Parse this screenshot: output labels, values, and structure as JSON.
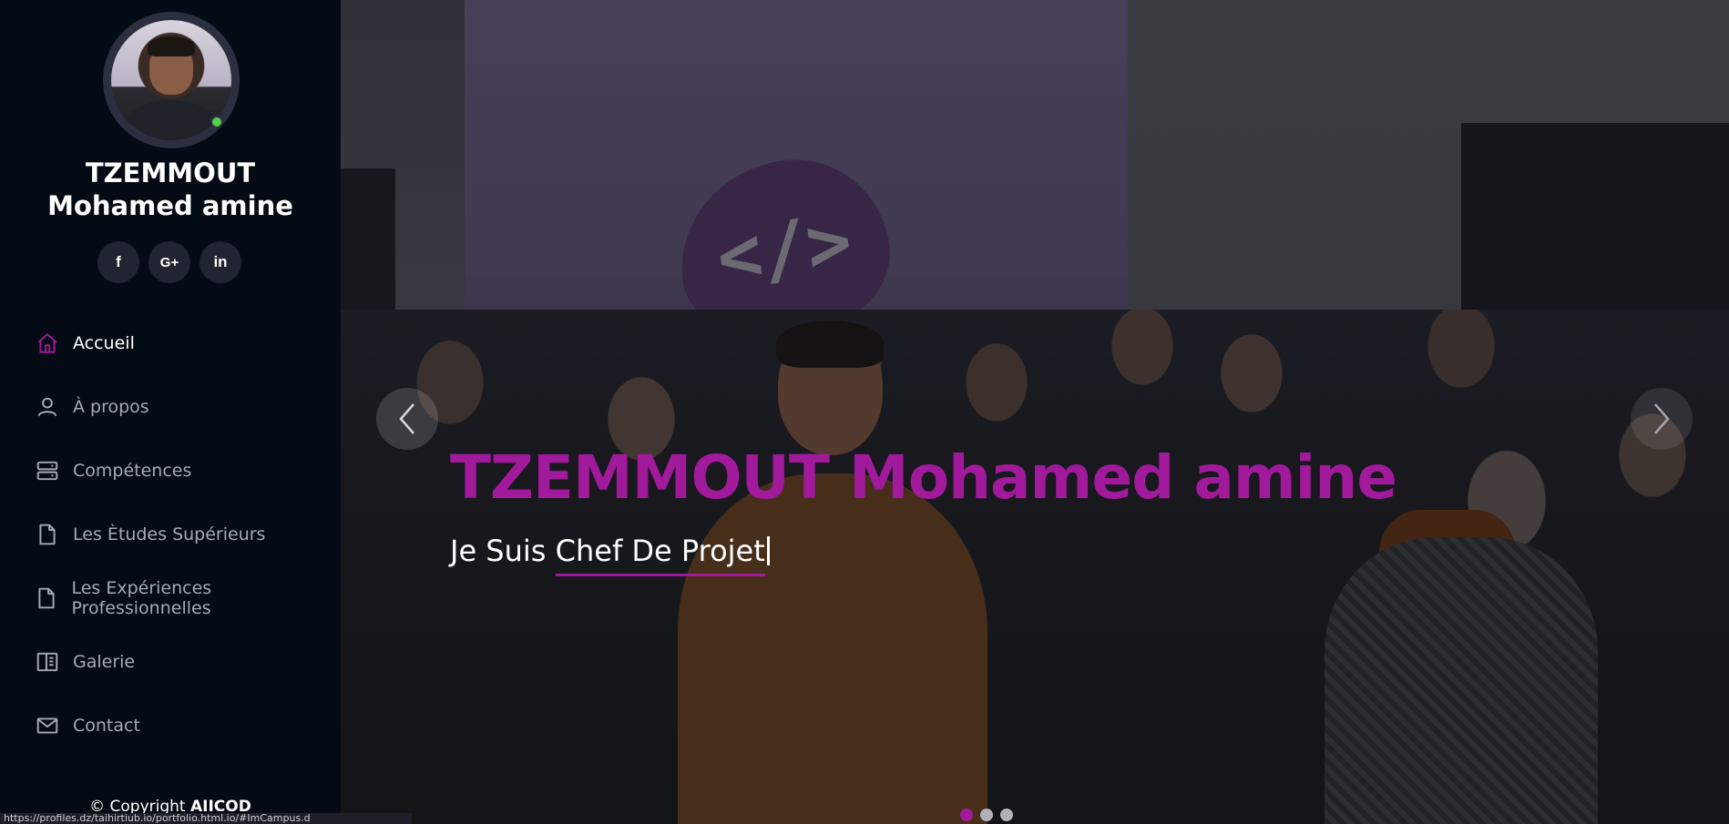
{
  "profile": {
    "name": "TZEMMOUT Mohamed amine",
    "online_status_color": "#4ed34e"
  },
  "socials": [
    {
      "name": "facebook",
      "label": "f"
    },
    {
      "name": "google-plus",
      "label": "G+"
    },
    {
      "name": "linkedin",
      "label": "in"
    }
  ],
  "nav": {
    "items": [
      {
        "label": "Accueil",
        "icon": "home-icon",
        "active": true
      },
      {
        "label": "À propos",
        "icon": "user-icon",
        "active": false
      },
      {
        "label": "Compétences",
        "icon": "server-icon",
        "active": false
      },
      {
        "label": "Les Ètudes Supérieurs",
        "icon": "file-icon",
        "active": false
      },
      {
        "label": "Les Expériences Professionnelles",
        "icon": "file-icon",
        "active": false
      },
      {
        "label": "Galerie",
        "icon": "book-icon",
        "active": false
      },
      {
        "label": "Contact",
        "icon": "envelope-icon",
        "active": false
      }
    ]
  },
  "footer": {
    "copyright_prefix": "© Copyright ",
    "copyright_brand": "AIICOD"
  },
  "statusbar": {
    "url": "https://profiles.dz/taihirtiub.io/portfolio.html.io/#ImCampus.d"
  },
  "hero": {
    "title": "TZEMMOUT Mohamed amine",
    "subtitle_prefix": "Je Suis ",
    "subtitle_typed": "Chef De Projet",
    "logo_symbol": "</>",
    "slides": 3,
    "active_slide": 0
  },
  "colors": {
    "accent": "#a01a9b",
    "sidebar_bg": "#040b14",
    "social_bg": "#212431"
  }
}
